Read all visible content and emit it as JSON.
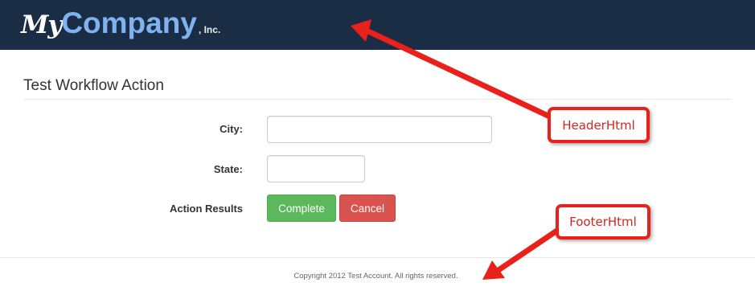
{
  "header": {
    "logo": {
      "my": "My",
      "company": "Company",
      "suffix": ", Inc."
    },
    "background_color": "#1b2d45"
  },
  "main": {
    "title": "Test Workflow Action",
    "fields": [
      {
        "label": "City:",
        "value": ""
      },
      {
        "label": "State:",
        "value": ""
      }
    ],
    "action_results_label": "Action Results",
    "buttons": {
      "complete": {
        "label": "Complete",
        "color": "#5cb85c"
      },
      "cancel": {
        "label": "Cancel",
        "color": "#d9534f"
      }
    }
  },
  "footer": {
    "copyright": "Copyright 2012 Test Account. All rights reserved."
  },
  "annotations": {
    "header_callout": "HeaderHtml",
    "footer_callout": "FooterHtml",
    "color": "#e8211b"
  }
}
